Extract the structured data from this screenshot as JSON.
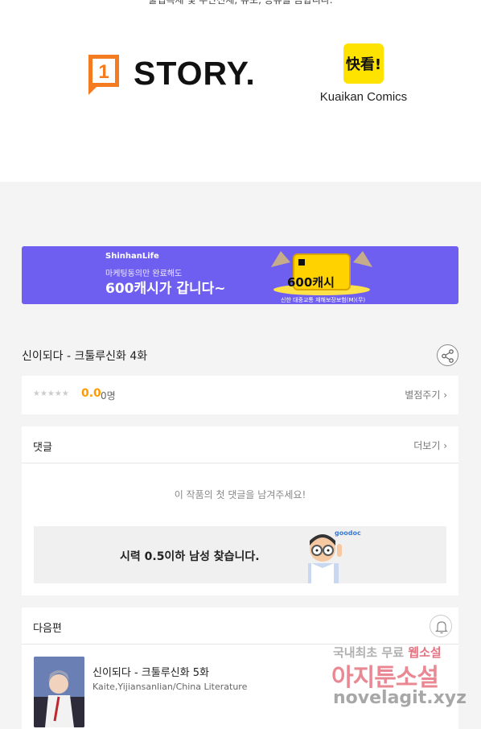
{
  "top": {
    "note": "불법복제 및 무단전재, 유포, 공유를 금합니다.",
    "story_logo_text": "STORY.",
    "story_badge_text": "1",
    "kuaikan_logo_text": "快看!",
    "kuaikan_name": "Kuaikan Comics"
  },
  "banner": {
    "brand": "ShinhanLife",
    "sub": "마케팅동의만 완료해도",
    "main": "600캐시가 갑니다~",
    "coin_label": "600캐시",
    "footnote": "신한 대중교통 재해보장보험(M)(무)",
    "accent": "#6f5ff0"
  },
  "episode": {
    "title": "신이되다 - 크툴루신화 4화",
    "share_icon": "share-icon"
  },
  "rating": {
    "stars": "★★★★★",
    "score": "0.0",
    "count": "0명",
    "rate_link": "별점주기 ›"
  },
  "comments": {
    "title": "댓글",
    "more": "더보기 ›",
    "empty_text": "이 작품의 첫 댓글을 남겨주세요!",
    "ad_text": "시력 0.5이하 남성 찾습니다.",
    "ad_brand": "goodoc"
  },
  "next": {
    "title": "다음편",
    "bell_icon": "bell-icon",
    "episode_title": "신이되다 - 크툴루신화 5화",
    "authors": "Kaite,Yijiansanlian/China Literature"
  },
  "watermark": {
    "line1_a": "국내최초 무료",
    "line1_b": "웹소설",
    "line2": "아지툰소설",
    "line3": "novelagit.xyz"
  }
}
